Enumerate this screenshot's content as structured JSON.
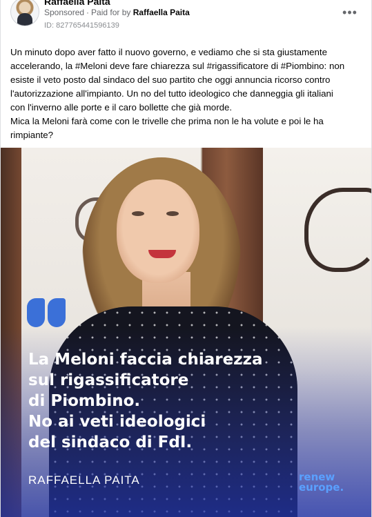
{
  "post": {
    "author": "Raffaella Paita",
    "sponsored_label": "Sponsored",
    "separator": "·",
    "paid_for_label": "Paid for by",
    "payer": "Raffaella Paita",
    "ad_id": "ID: 827765441596139",
    "more_icon": "more-options-icon",
    "caption_lines": [
      "Un minuto dopo aver fatto il nuovo governo, e vediamo che si sta giustamente",
      "accelerando, la #Meloni deve fare chiarezza sul #rigassificatore di #Piombino: non",
      "esiste il veto posto dal sindaco del suo partito che oggi annuncia ricorso contro",
      "l'autorizzazione all'impianto. Un no del tutto ideologico che danneggia gli italiani",
      "con l'inverno alle porte e il caro bollette che già morde.",
      "Mica la Meloni farà come con le trivelle che prima non le ha volute e poi le ha",
      "rimpiante?"
    ]
  },
  "creative": {
    "headline_lines": [
      "La Meloni faccia chiarezza",
      "sul rigassificatore",
      "di Piombino.",
      "No ai veti ideologici",
      "del sindaco di FdI."
    ],
    "signature": "RAFFAELLA PAITA",
    "brand_line1": "renew",
    "brand_line2": "europe.",
    "colors": {
      "quote_mark": "#3b70d8",
      "overlay_blue": "#2134aa",
      "brand": "#5aa0ff"
    }
  }
}
